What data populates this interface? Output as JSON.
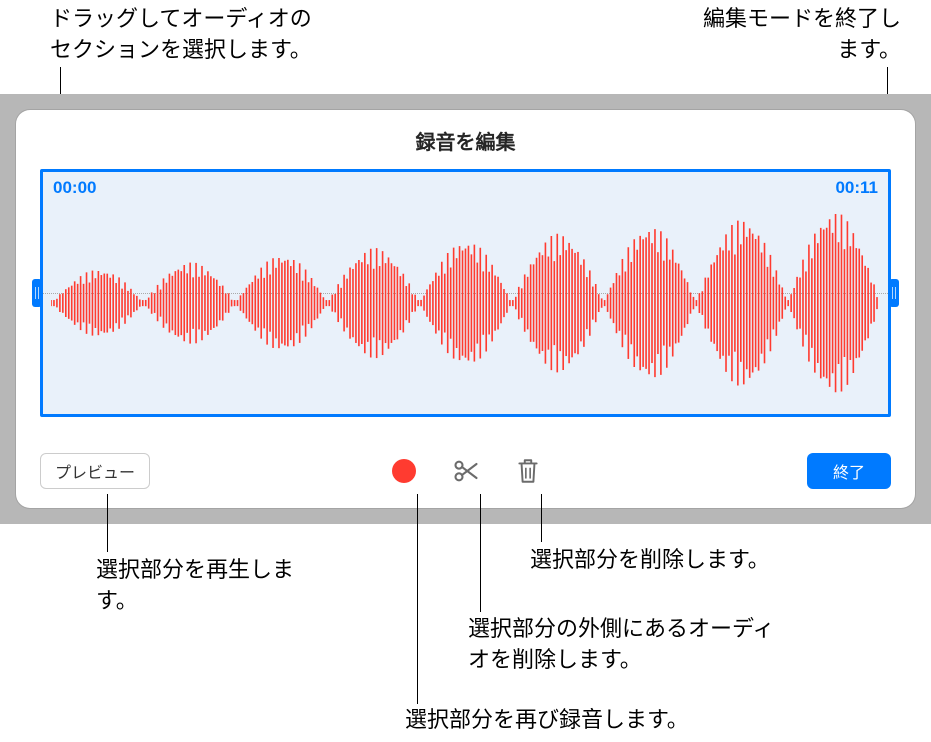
{
  "callouts": {
    "drag_select": "ドラッグしてオーディオのセクションを選択します。",
    "exit_edit": "編集モードを終了します。",
    "play_selection": "選択部分を再生します。",
    "delete_selection": "選択部分を削除します。",
    "trim_outside": "選択部分の外側にあるオーディオを削除します。",
    "rerecord_selection": "選択部分を再び録音します。"
  },
  "panel": {
    "title": "録音を編集",
    "time_start": "00:00",
    "time_end": "00:11"
  },
  "toolbar": {
    "preview_label": "プレビュー",
    "done_label": "終了"
  }
}
